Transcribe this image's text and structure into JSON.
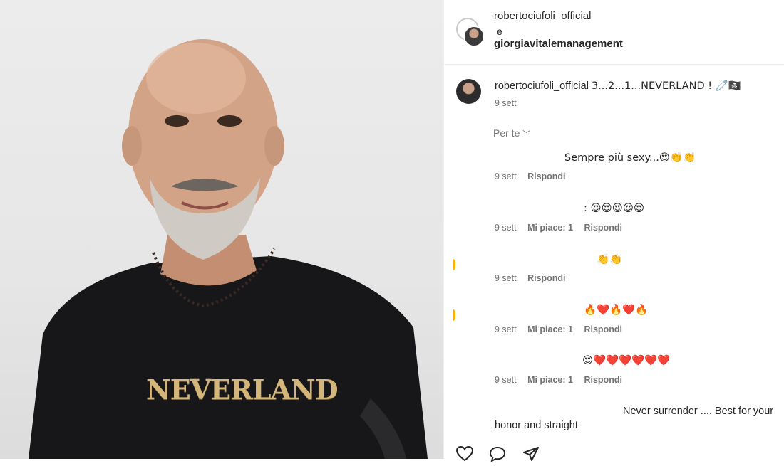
{
  "post": {
    "shirt_text": "NEVERLAND"
  },
  "header": {
    "user1": "robertociufoli_official",
    "conjunction": "e",
    "user2": "giorgiavitalemanagement"
  },
  "caption": {
    "username": "robertociufoli_official",
    "text": "3...2...1...NEVERLAND ! 🧷🏴‍☠️",
    "date": "9 sett"
  },
  "filter": {
    "label": "Per te",
    "chevron": "﹀"
  },
  "comments": [
    {
      "text": "Sempre più sexy...😍👏👏",
      "date": "9 sett",
      "likes": "",
      "reply": "Rispondi"
    },
    {
      "text": ": 😍😍😍😍😍",
      "date": "9 sett",
      "likes": "Mi piace: 1",
      "reply": "Rispondi"
    },
    {
      "text": "👏👏",
      "date": "9 sett",
      "likes": "",
      "reply": "Rispondi"
    },
    {
      "text": "🔥❤️🔥❤️🔥",
      "date": "9 sett",
      "likes": "Mi piace: 1",
      "reply": "Rispondi"
    },
    {
      "text": "😍❤️❤️❤️❤️❤️❤️",
      "date": "9 sett",
      "likes": "Mi piace: 1",
      "reply": "Rispondi"
    },
    {
      "text": "Never surrender .... Best for your",
      "text2": "honor and straight"
    }
  ],
  "actions": {
    "like_icon": "heart-icon",
    "comment_icon": "comment-icon",
    "share_icon": "share-icon"
  }
}
